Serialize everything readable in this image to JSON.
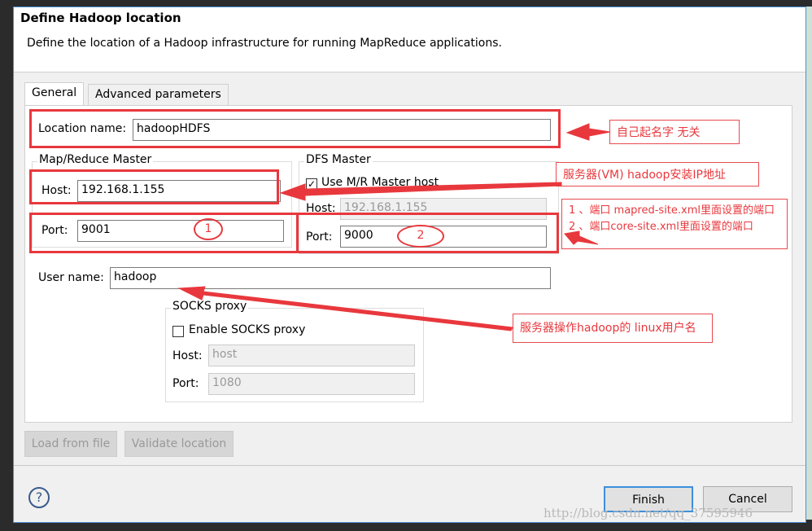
{
  "dialog": {
    "title": "Define Hadoop location",
    "description": "Define the location of a Hadoop infrastructure for running MapReduce applications."
  },
  "tabs": [
    {
      "label": "General",
      "active": true
    },
    {
      "label": "Advanced parameters",
      "active": false
    }
  ],
  "form": {
    "location_name_label": "Location name:",
    "location_name": "hadoopHDFS",
    "mr_master": {
      "title": "Map/Reduce Master",
      "host_label": "Host:",
      "host": "192.168.1.155",
      "port_label": "Port:",
      "port": "9001"
    },
    "dfs_master": {
      "title": "DFS Master",
      "use_mr_label": "Use M/R Master host",
      "use_mr_checked": true,
      "host_label": "Host:",
      "host": "192.168.1.155",
      "port_label": "Port:",
      "port": "9000"
    },
    "user_name_label": "User name:",
    "user_name": "hadoop",
    "socks": {
      "title": "SOCKS proxy",
      "enable_label": "Enable SOCKS proxy",
      "enable_checked": false,
      "host_label": "Host:",
      "host": "host",
      "port_label": "Port:",
      "port": "1080"
    }
  },
  "buttons": {
    "load": "Load from file",
    "validate": "Validate location",
    "finish": "Finish",
    "cancel": "Cancel"
  },
  "annotations": {
    "name_note": "自己起名字 无关",
    "host_note": "服务器(VM) hadoop安装IP地址",
    "port_note_1": "1 、端口 mapred-site.xml里面设置的端口",
    "port_note_2": "2 、端口core-site.xml里面设置的端口",
    "user_note": "服务器操作hadoop的 linux用户名",
    "circle_1": "1",
    "circle_2": "2",
    "color": "#e8383d"
  },
  "watermark": "http://blog.csdn.net/qq_37595946"
}
